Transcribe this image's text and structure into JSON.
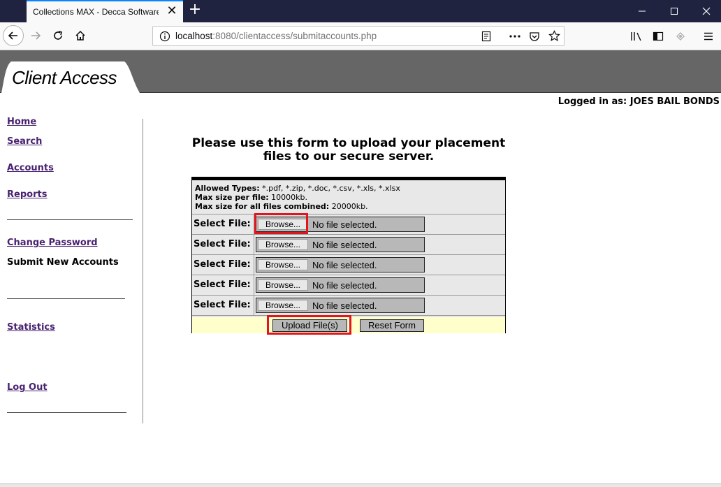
{
  "browser": {
    "tab_title": "Collections MAX - Decca Software C",
    "new_tab_symbol": "+",
    "url_host": "localhost",
    "url_rest": ":8080/clientaccess/submitaccounts.php"
  },
  "header": {
    "title": "Client Access",
    "logged_in": "Logged in as: JOES BAIL BONDS"
  },
  "sidebar": {
    "home": "Home",
    "search": "Search",
    "accounts": "Accounts",
    "reports": "Reports",
    "change_password": "Change Password",
    "submit_new_accounts": "Submit New Accounts",
    "statistics": "Statistics",
    "log_out": "Log Out"
  },
  "form": {
    "heading": "Please use this form to upload your placement files to our secure server.",
    "allowed_types_label": "Allowed Types:",
    "allowed_types_value": " *.pdf, *.zip, *.doc, *.csv, *.xls, *.xlsx",
    "max_file_label": "Max size per file:",
    "max_file_value": " 10000kb.",
    "max_total_label": "Max size for all files combined:",
    "max_total_value": " 20000kb.",
    "select_label": "Select File:",
    "browse_label": "Browse...",
    "no_file": "No file selected.",
    "upload_label": "Upload File(s)",
    "reset_label": "Reset Form"
  },
  "colors": {
    "header_bg": "#666666",
    "link": "#4a2370",
    "highlight": "#e0151f",
    "button_row_bg": "#ffffcc"
  }
}
